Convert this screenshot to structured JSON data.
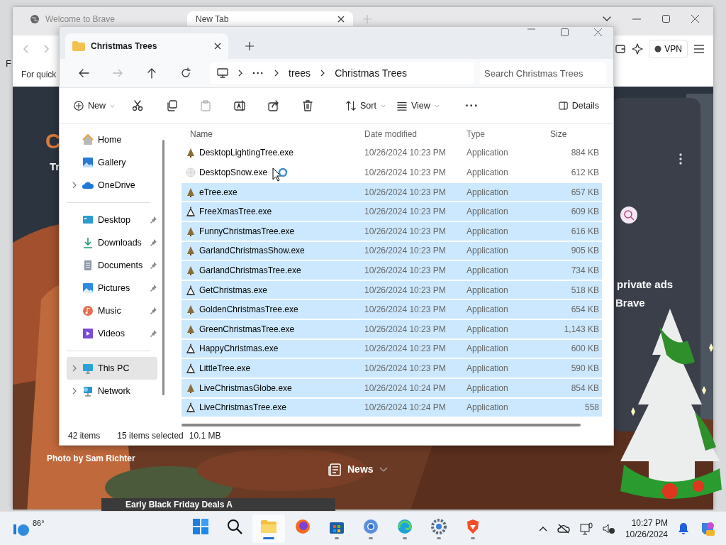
{
  "desktop": {
    "behind_text": "F"
  },
  "browser": {
    "tabs": [
      {
        "label": "Welcome to Brave",
        "selected": false
      },
      {
        "label": "New Tab",
        "selected": true
      }
    ],
    "vpn_label": "VPN",
    "bookmarks_hint": "For quick",
    "new_tab": {
      "heading_fragment": "C",
      "subheading_fragment": "Tr",
      "card_heading": "private ads",
      "card_subheading": "Brave",
      "photo_credit": "Photo by Sam Richter",
      "news_label": "News",
      "news_card_title": "Early Black Friday Deals A"
    }
  },
  "explorer": {
    "tab_title": "Christmas Trees",
    "breadcrumb": [
      {
        "label": "···"
      },
      {
        "label": "trees"
      },
      {
        "label": "Christmas Trees"
      }
    ],
    "search": {
      "placeholder": "Search Christmas Trees"
    },
    "commands": [
      {
        "kind": "new",
        "label": "New",
        "disabled": false
      },
      {
        "kind": "cut",
        "disabled": false
      },
      {
        "kind": "copy",
        "disabled": false
      },
      {
        "kind": "paste",
        "disabled": true
      },
      {
        "kind": "rename",
        "disabled": false
      },
      {
        "kind": "share",
        "disabled": false
      },
      {
        "kind": "delete",
        "disabled": false
      },
      {
        "kind": "sort",
        "label": "Sort",
        "disabled": false
      },
      {
        "kind": "view",
        "label": "View",
        "disabled": false
      },
      {
        "kind": "more",
        "label": "···",
        "disabled": false
      },
      {
        "kind": "details",
        "label": "Details",
        "disabled": false
      }
    ],
    "sidebar": [
      [
        {
          "label": "Home",
          "kind": "home",
          "expandable": false,
          "pinned": false,
          "selected": false
        },
        {
          "label": "Gallery",
          "kind": "gallery",
          "expandable": false,
          "pinned": false,
          "selected": false
        },
        {
          "label": "OneDrive",
          "kind": "cloud",
          "expandable": true,
          "pinned": false,
          "selected": false
        }
      ],
      [
        {
          "label": "Desktop",
          "kind": "desktop",
          "expandable": false,
          "pinned": true,
          "selected": false
        },
        {
          "label": "Downloads",
          "kind": "download",
          "expandable": false,
          "pinned": true,
          "selected": false
        },
        {
          "label": "Documents",
          "kind": "document",
          "expandable": false,
          "pinned": true,
          "selected": false
        },
        {
          "label": "Pictures",
          "kind": "pictures",
          "expandable": false,
          "pinned": true,
          "selected": false
        },
        {
          "label": "Music",
          "kind": "music",
          "expandable": false,
          "pinned": true,
          "selected": false
        },
        {
          "label": "Videos",
          "kind": "videos",
          "expandable": false,
          "pinned": true,
          "selected": false
        }
      ],
      [
        {
          "label": "This PC",
          "kind": "pc",
          "expandable": true,
          "pinned": false,
          "selected": true
        },
        {
          "label": "Network",
          "kind": "network",
          "expandable": true,
          "pinned": false,
          "selected": false
        }
      ]
    ],
    "columns": [
      "Name",
      "Date modified",
      "Type",
      "Size"
    ],
    "rows": [
      {
        "name": "DesktopLightingTree.exe",
        "date": "10/26/2024 10:23 PM",
        "type": "Application",
        "size": "884 KB",
        "kind": "tree",
        "selected": false
      },
      {
        "name": "DesktopSnow.exe",
        "date": "10/26/2024 10:23 PM",
        "type": "Application",
        "size": "612 KB",
        "kind": "snow",
        "selected": false
      },
      {
        "name": "eTree.exe",
        "date": "10/26/2024 10:23 PM",
        "type": "Application",
        "size": "657 KB",
        "kind": "tree",
        "selected": true
      },
      {
        "name": "FreeXmasTree.exe",
        "date": "10/26/2024 10:23 PM",
        "type": "Application",
        "size": "609 KB",
        "kind": "star-tree",
        "selected": true
      },
      {
        "name": "FunnyChristmasTree.exe",
        "date": "10/26/2024 10:23 PM",
        "type": "Application",
        "size": "616 KB",
        "kind": "tree",
        "selected": true
      },
      {
        "name": "GarlandChristmasShow.exe",
        "date": "10/26/2024 10:23 PM",
        "type": "Application",
        "size": "905 KB",
        "kind": "tree",
        "selected": true
      },
      {
        "name": "GarlandChristmasTree.exe",
        "date": "10/26/2024 10:23 PM",
        "type": "Application",
        "size": "734 KB",
        "kind": "tree",
        "selected": true
      },
      {
        "name": "GetChristmas.exe",
        "date": "10/26/2024 10:23 PM",
        "type": "Application",
        "size": "518 KB",
        "kind": "star-tree",
        "selected": true
      },
      {
        "name": "GoldenChristmasTree.exe",
        "date": "10/26/2024 10:23 PM",
        "type": "Application",
        "size": "654 KB",
        "kind": "tree",
        "selected": true
      },
      {
        "name": "GreenChristmasTree.exe",
        "date": "10/26/2024 10:23 PM",
        "type": "Application",
        "size": "1,143 KB",
        "kind": "tree",
        "selected": true
      },
      {
        "name": "HappyChristmas.exe",
        "date": "10/26/2024 10:23 PM",
        "type": "Application",
        "size": "600 KB",
        "kind": "star-tree",
        "selected": true
      },
      {
        "name": "LittleTree.exe",
        "date": "10/26/2024 10:23 PM",
        "type": "Application",
        "size": "590 KB",
        "kind": "star-tree",
        "selected": true
      },
      {
        "name": "LiveChristmasGlobe.exe",
        "date": "10/26/2024 10:24 PM",
        "type": "Application",
        "size": "854 KB",
        "kind": "tree",
        "selected": true
      },
      {
        "name": "LiveChristmasTree.exe",
        "date": "10/26/2024 10:24 PM",
        "type": "Application",
        "size": "558",
        "kind": "star-tree",
        "selected": true
      }
    ],
    "status": {
      "count": "42 items",
      "selection": "15 items selected",
      "size": "10.1 MB"
    }
  },
  "taskbar": {
    "weather": "86°",
    "apps": [
      {
        "kind": "start",
        "running": false,
        "active": false
      },
      {
        "kind": "search",
        "running": false,
        "active": false
      },
      {
        "kind": "files",
        "running": true,
        "active": true
      },
      {
        "kind": "fox",
        "running": false,
        "active": false
      },
      {
        "kind": "store",
        "running": true,
        "active": false
      },
      {
        "kind": "ring",
        "running": true,
        "active": false
      },
      {
        "kind": "swirl",
        "running": true,
        "active": false
      },
      {
        "kind": "gear",
        "running": true,
        "active": false
      },
      {
        "kind": "shield",
        "running": true,
        "active": false
      }
    ],
    "time": "10:27 PM",
    "date": "10/26/2024"
  }
}
